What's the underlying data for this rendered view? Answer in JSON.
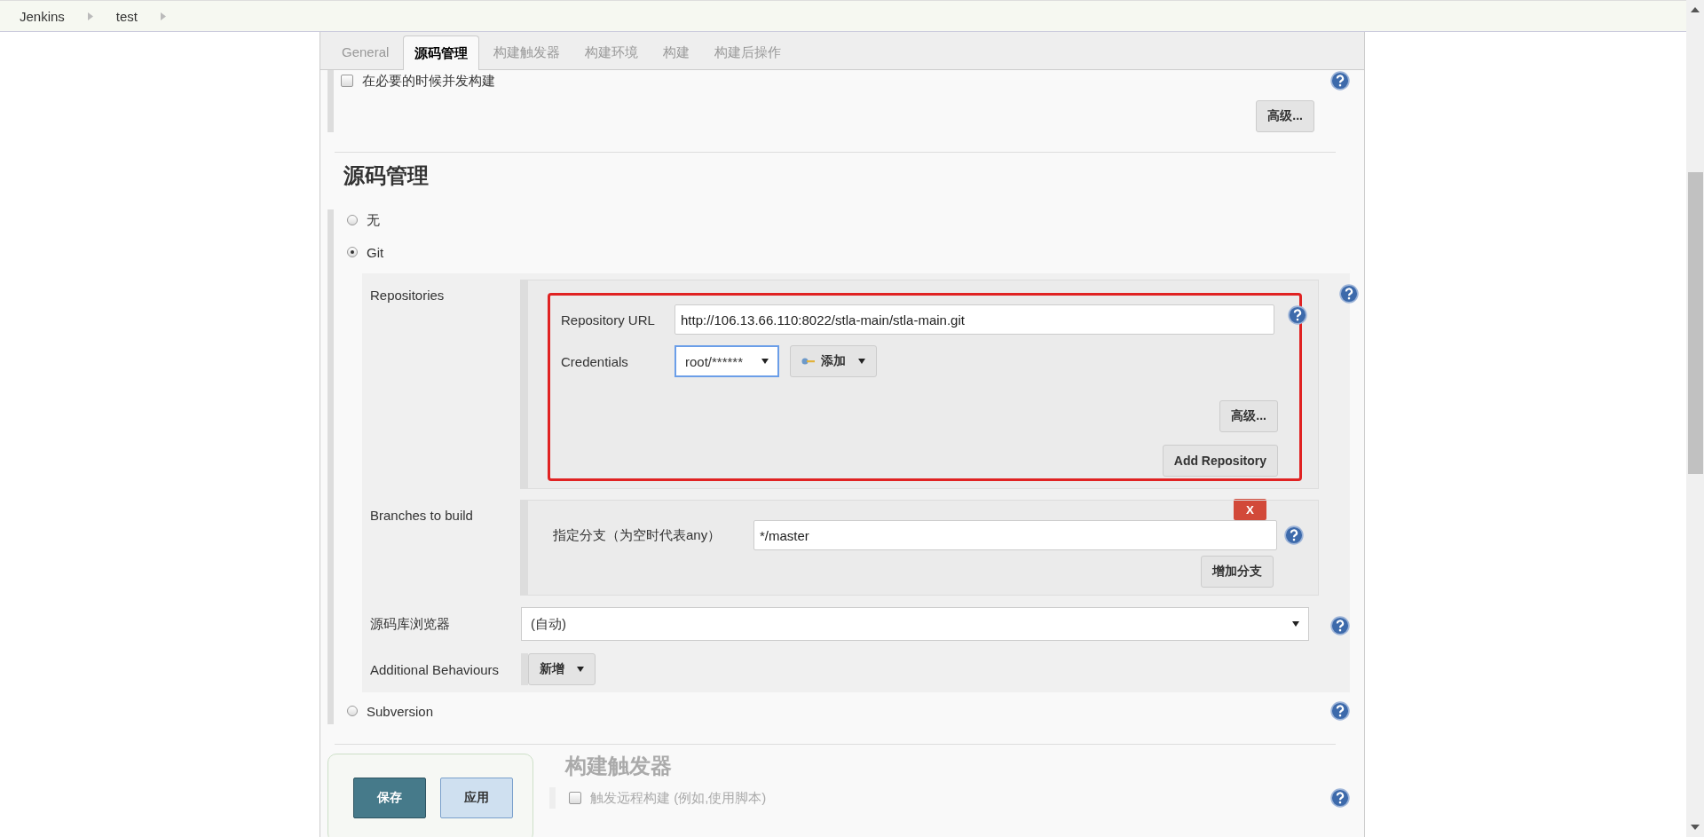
{
  "breadcrumbs": [
    "Jenkins",
    "test"
  ],
  "tabs": [
    {
      "label": "General",
      "selected": false
    },
    {
      "label": "源码管理",
      "selected": true
    },
    {
      "label": "构建触发器",
      "selected": false
    },
    {
      "label": "构建环境",
      "selected": false
    },
    {
      "label": "构建",
      "selected": false
    },
    {
      "label": "构建后操作",
      "selected": false
    }
  ],
  "concurrent_build": {
    "label": "在必要的时候并发构建",
    "checked": false
  },
  "advanced_button": "高级...",
  "scm": {
    "heading": "源码管理",
    "options": [
      {
        "label": "无",
        "selected": false
      },
      {
        "label": "Git",
        "selected": true
      },
      {
        "label": "Subversion",
        "selected": false
      }
    ],
    "repositories": {
      "label": "Repositories",
      "url_label": "Repository URL",
      "url": "http://106.13.66.110:8022/stla-main/stla-main.git",
      "credentials_label": "Credentials",
      "credentials": "root/******",
      "add_button": "添加",
      "advanced_button": "高级...",
      "add_repository_button": "Add Repository"
    },
    "branches": {
      "label": "Branches to build",
      "delete_button": "X",
      "spec_label": "指定分支（为空时代表any）",
      "spec": "*/master",
      "add_branch_button": "增加分支"
    },
    "browser": {
      "label": "源码库浏览器",
      "value": "(自动)"
    },
    "behaviours": {
      "label": "Additional Behaviours",
      "add_button": "新增"
    }
  },
  "triggers": {
    "heading": "构建触发器",
    "items": [
      {
        "label": "触发远程构建 (例如,使用脚本)",
        "checked": false
      }
    ]
  },
  "footer_buttons": [
    {
      "label": "保存",
      "kind": "primary"
    },
    {
      "label": "应用",
      "kind": "secondary"
    }
  ]
}
